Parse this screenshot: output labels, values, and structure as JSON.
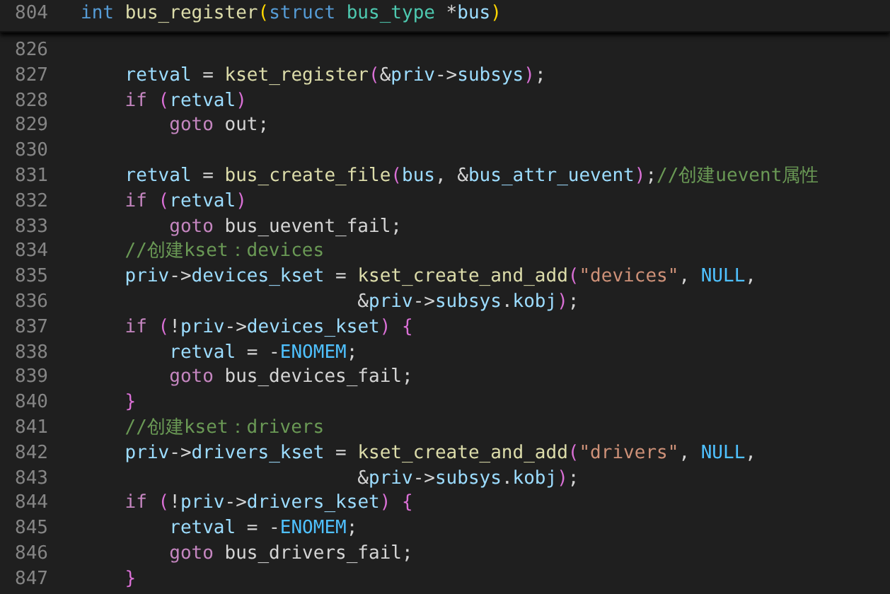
{
  "sticky_line": {
    "number": "804",
    "tokens": [
      {
        "kind": "keyword",
        "text": "int "
      },
      {
        "kind": "func",
        "text": "bus_register"
      },
      {
        "kind": "bracket1",
        "text": "("
      },
      {
        "kind": "keyword",
        "text": "struct "
      },
      {
        "kind": "type",
        "text": "bus_type"
      },
      {
        "kind": "plain",
        "text": " *"
      },
      {
        "kind": "var",
        "text": "bus"
      },
      {
        "kind": "bracket1",
        "text": ")"
      }
    ]
  },
  "lines": [
    {
      "number": "826"
    },
    {
      "number": "827",
      "tokens": [
        {
          "kind": "var",
          "text": "    retval"
        },
        {
          "kind": "plain",
          "text": " = "
        },
        {
          "kind": "func",
          "text": "kset_register"
        },
        {
          "kind": "bracket2",
          "text": "("
        },
        {
          "kind": "plain",
          "text": "&"
        },
        {
          "kind": "var",
          "text": "priv"
        },
        {
          "kind": "plain",
          "text": "->"
        },
        {
          "kind": "var",
          "text": "subsys"
        },
        {
          "kind": "bracket2",
          "text": ")"
        },
        {
          "kind": "plain",
          "text": ";"
        }
      ]
    },
    {
      "number": "828",
      "tokens": [
        {
          "kind": "control",
          "text": "    if "
        },
        {
          "kind": "bracket2",
          "text": "("
        },
        {
          "kind": "var",
          "text": "retval"
        },
        {
          "kind": "bracket2",
          "text": ")"
        }
      ]
    },
    {
      "number": "829",
      "tokens": [
        {
          "kind": "control",
          "text": "        goto"
        },
        {
          "kind": "plain",
          "text": " out;"
        }
      ]
    },
    {
      "number": "830"
    },
    {
      "number": "831",
      "tokens": [
        {
          "kind": "var",
          "text": "    retval"
        },
        {
          "kind": "plain",
          "text": " = "
        },
        {
          "kind": "func",
          "text": "bus_create_file"
        },
        {
          "kind": "bracket2",
          "text": "("
        },
        {
          "kind": "var",
          "text": "bus"
        },
        {
          "kind": "plain",
          "text": ", &"
        },
        {
          "kind": "var",
          "text": "bus_attr_uevent"
        },
        {
          "kind": "bracket2",
          "text": ")"
        },
        {
          "kind": "plain",
          "text": ";"
        },
        {
          "kind": "comment",
          "text": "//创建uevent属性"
        }
      ]
    },
    {
      "number": "832",
      "tokens": [
        {
          "kind": "control",
          "text": "    if "
        },
        {
          "kind": "bracket2",
          "text": "("
        },
        {
          "kind": "var",
          "text": "retval"
        },
        {
          "kind": "bracket2",
          "text": ")"
        }
      ]
    },
    {
      "number": "833",
      "tokens": [
        {
          "kind": "control",
          "text": "        goto"
        },
        {
          "kind": "plain",
          "text": " bus_uevent_fail;"
        }
      ]
    },
    {
      "number": "834",
      "tokens": [
        {
          "kind": "comment",
          "text": "    //创建kset：devices"
        }
      ]
    },
    {
      "number": "835",
      "tokens": [
        {
          "kind": "var",
          "text": "    priv"
        },
        {
          "kind": "plain",
          "text": "->"
        },
        {
          "kind": "var",
          "text": "devices_kset"
        },
        {
          "kind": "plain",
          "text": " = "
        },
        {
          "kind": "func",
          "text": "kset_create_and_add"
        },
        {
          "kind": "bracket2",
          "text": "("
        },
        {
          "kind": "string",
          "text": "\"devices\""
        },
        {
          "kind": "plain",
          "text": ", "
        },
        {
          "kind": "constant",
          "text": "NULL"
        },
        {
          "kind": "plain",
          "text": ","
        }
      ]
    },
    {
      "number": "836",
      "tokens": [
        {
          "kind": "plain",
          "text": "                         &"
        },
        {
          "kind": "var",
          "text": "priv"
        },
        {
          "kind": "plain",
          "text": "->"
        },
        {
          "kind": "var",
          "text": "subsys"
        },
        {
          "kind": "plain",
          "text": "."
        },
        {
          "kind": "var",
          "text": "kobj"
        },
        {
          "kind": "bracket2",
          "text": ")"
        },
        {
          "kind": "plain",
          "text": ";"
        }
      ]
    },
    {
      "number": "837",
      "tokens": [
        {
          "kind": "control",
          "text": "    if "
        },
        {
          "kind": "bracket2",
          "text": "("
        },
        {
          "kind": "plain",
          "text": "!"
        },
        {
          "kind": "var",
          "text": "priv"
        },
        {
          "kind": "plain",
          "text": "->"
        },
        {
          "kind": "var",
          "text": "devices_kset"
        },
        {
          "kind": "bracket2",
          "text": ")"
        },
        {
          "kind": "bracket2",
          "text": " {"
        }
      ]
    },
    {
      "number": "838",
      "tokens": [
        {
          "kind": "var",
          "text": "        retval"
        },
        {
          "kind": "plain",
          "text": " = -"
        },
        {
          "kind": "constant",
          "text": "ENOMEM"
        },
        {
          "kind": "plain",
          "text": ";"
        }
      ]
    },
    {
      "number": "839",
      "tokens": [
        {
          "kind": "control",
          "text": "        goto"
        },
        {
          "kind": "plain",
          "text": " bus_devices_fail;"
        }
      ]
    },
    {
      "number": "840",
      "tokens": [
        {
          "kind": "bracket2",
          "text": "    }"
        }
      ]
    },
    {
      "number": "841",
      "tokens": [
        {
          "kind": "comment",
          "text": "    //创建kset：drivers"
        }
      ]
    },
    {
      "number": "842",
      "tokens": [
        {
          "kind": "var",
          "text": "    priv"
        },
        {
          "kind": "plain",
          "text": "->"
        },
        {
          "kind": "var",
          "text": "drivers_kset"
        },
        {
          "kind": "plain",
          "text": " = "
        },
        {
          "kind": "func",
          "text": "kset_create_and_add"
        },
        {
          "kind": "bracket2",
          "text": "("
        },
        {
          "kind": "string",
          "text": "\"drivers\""
        },
        {
          "kind": "plain",
          "text": ", "
        },
        {
          "kind": "constant",
          "text": "NULL"
        },
        {
          "kind": "plain",
          "text": ","
        }
      ]
    },
    {
      "number": "843",
      "tokens": [
        {
          "kind": "plain",
          "text": "                         &"
        },
        {
          "kind": "var",
          "text": "priv"
        },
        {
          "kind": "plain",
          "text": "->"
        },
        {
          "kind": "var",
          "text": "subsys"
        },
        {
          "kind": "plain",
          "text": "."
        },
        {
          "kind": "var",
          "text": "kobj"
        },
        {
          "kind": "bracket2",
          "text": ")"
        },
        {
          "kind": "plain",
          "text": ";"
        }
      ]
    },
    {
      "number": "844",
      "tokens": [
        {
          "kind": "control",
          "text": "    if "
        },
        {
          "kind": "bracket2",
          "text": "("
        },
        {
          "kind": "plain",
          "text": "!"
        },
        {
          "kind": "var",
          "text": "priv"
        },
        {
          "kind": "plain",
          "text": "->"
        },
        {
          "kind": "var",
          "text": "drivers_kset"
        },
        {
          "kind": "bracket2",
          "text": ")"
        },
        {
          "kind": "bracket2",
          "text": " {"
        }
      ]
    },
    {
      "number": "845",
      "tokens": [
        {
          "kind": "var",
          "text": "        retval"
        },
        {
          "kind": "plain",
          "text": " = -"
        },
        {
          "kind": "constant",
          "text": "ENOMEM"
        },
        {
          "kind": "plain",
          "text": ";"
        }
      ]
    },
    {
      "number": "846",
      "tokens": [
        {
          "kind": "control",
          "text": "        goto"
        },
        {
          "kind": "plain",
          "text": " bus_drivers_fail;"
        }
      ]
    },
    {
      "number": "847",
      "tokens": [
        {
          "kind": "bracket2",
          "text": "    }"
        }
      ]
    }
  ]
}
